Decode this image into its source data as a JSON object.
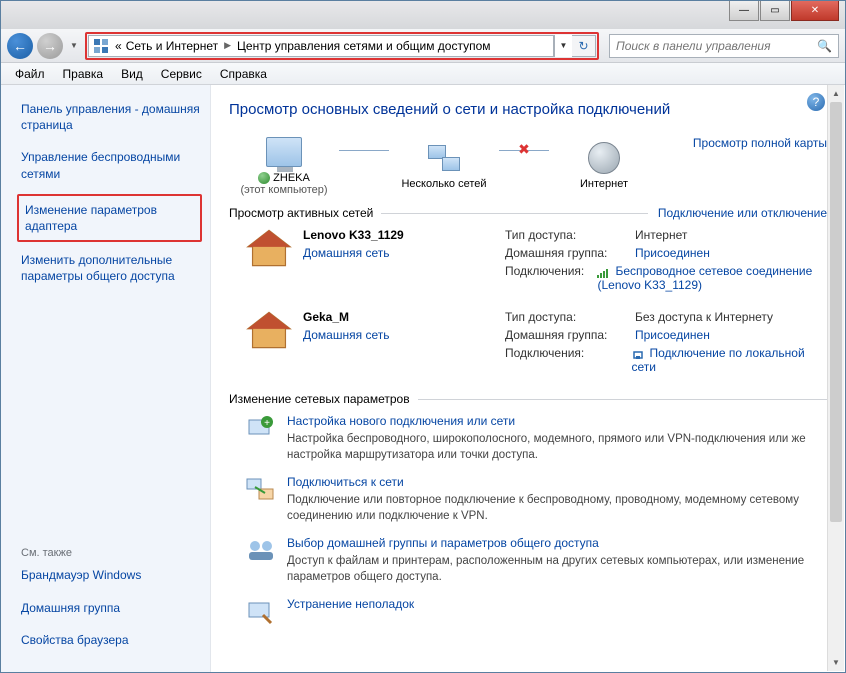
{
  "titlebar": {},
  "nav": {
    "breadcrumb_prefix": "«",
    "seg1": "Сеть и Интернет",
    "seg2": "Центр управления сетями и общим доступом"
  },
  "search": {
    "placeholder": "Поиск в панели управления"
  },
  "menu": {
    "file": "Файл",
    "edit": "Правка",
    "view": "Вид",
    "tools": "Сервис",
    "help": "Справка"
  },
  "sidebar": {
    "home": "Панель управления - домашняя страница",
    "wireless": "Управление беспроводными сетями",
    "adapter": "Изменение параметров адаптера",
    "sharing": "Изменить дополнительные параметры общего доступа",
    "seealso": "См. также",
    "firewall": "Брандмауэр Windows",
    "homegroup": "Домашняя группа",
    "browser": "Свойства браузера"
  },
  "content": {
    "title": "Просмотр основных сведений о сети и настройка подключений",
    "map": {
      "node1": "ZHEKA",
      "node1_sub": "(этот компьютер)",
      "node2": "Несколько сетей",
      "node3": "Интернет",
      "fullmap": "Просмотр полной карты"
    },
    "active_hd": "Просмотр активных сетей",
    "active_link": "Подключение или отключение",
    "labels": {
      "access": "Тип доступа:",
      "homegroup": "Домашняя группа:",
      "connections": "Подключения:"
    },
    "net1": {
      "name": "Lenovo K33_1129",
      "type": "Домашняя сеть",
      "access": "Интернет",
      "homegroup": "Присоединен",
      "conn": "Беспроводное сетевое соединение (Lenovo K33_1129)"
    },
    "net2": {
      "name": "Geka_M",
      "type": "Домашняя сеть",
      "access": "Без доступа к Интернету",
      "homegroup": "Присоединен",
      "conn": "Подключение по локальной сети"
    },
    "change_hd": "Изменение сетевых параметров",
    "task1": {
      "title": "Настройка нового подключения или сети",
      "desc": "Настройка беспроводного, широкополосного, модемного, прямого или VPN-подключения или же настройка маршрутизатора или точки доступа."
    },
    "task2": {
      "title": "Подключиться к сети",
      "desc": "Подключение или повторное подключение к беспроводному, проводному, модемному сетевому соединению или подключение к VPN."
    },
    "task3": {
      "title": "Выбор домашней группы и параметров общего доступа",
      "desc": "Доступ к файлам и принтерам, расположенным на других сетевых компьютерах, или изменение параметров общего доступа."
    },
    "task4": {
      "title": "Устранение неполадок"
    }
  }
}
